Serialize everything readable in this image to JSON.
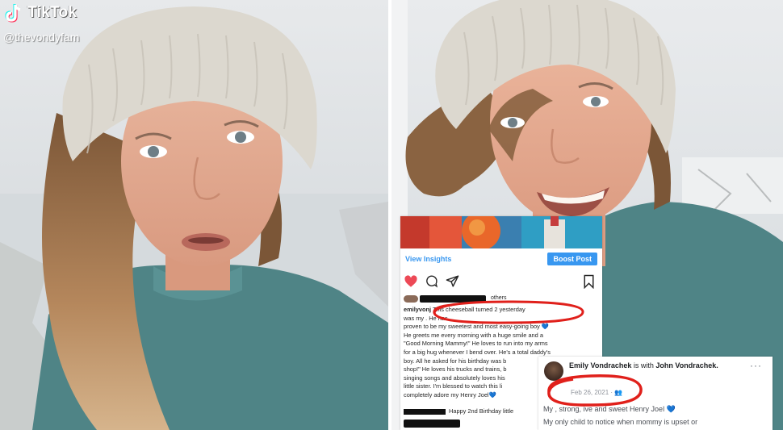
{
  "tiktok": {
    "brand": "TikTok",
    "handle": "@thevondyfam"
  },
  "instagram": {
    "view_insights_label": "View Insights",
    "boost_post_label": "Boost Post",
    "liked_by_suffix": "others",
    "caption": {
      "username": "emilyvonj",
      "highlighted": "This cheeseball turned 2 yesterday",
      "lines": [
        "was my                              . He has",
        "proven to be my sweetest and most easy-going boy 💙",
        "He greets me every morning with a huge smile and a",
        "\"Good Morning Mammy!\" He loves to run into my arms",
        "for a big hug whenever I bend over. He's a total daddy's",
        "boy. All he asked for his birthday was b",
        "shop!\" He loves his trucks and trains, b",
        "singing songs and absolutely loves his",
        "little sister. I'm blessed to watch this li",
        "completely adore my Henry Joel💙"
      ]
    },
    "birthday_line": "Happy 2nd Birthday little"
  },
  "facebook": {
    "author": "Emily Vondrachek",
    "with_text": "is with",
    "tagged": "John Vondrachek.",
    "date": "Feb 26, 2021 · 👥",
    "more": "···",
    "line1": "My      , strong,        ive and sweet Henry Joel 💙",
    "line2": "My only child to notice when mommy is upset or"
  },
  "colors": {
    "sweater": "#4f8486",
    "beanie": "#dcd8cf",
    "hair": "#8a6341",
    "instagram_blue": "#3897f0",
    "highlight_red": "#e0201b"
  }
}
